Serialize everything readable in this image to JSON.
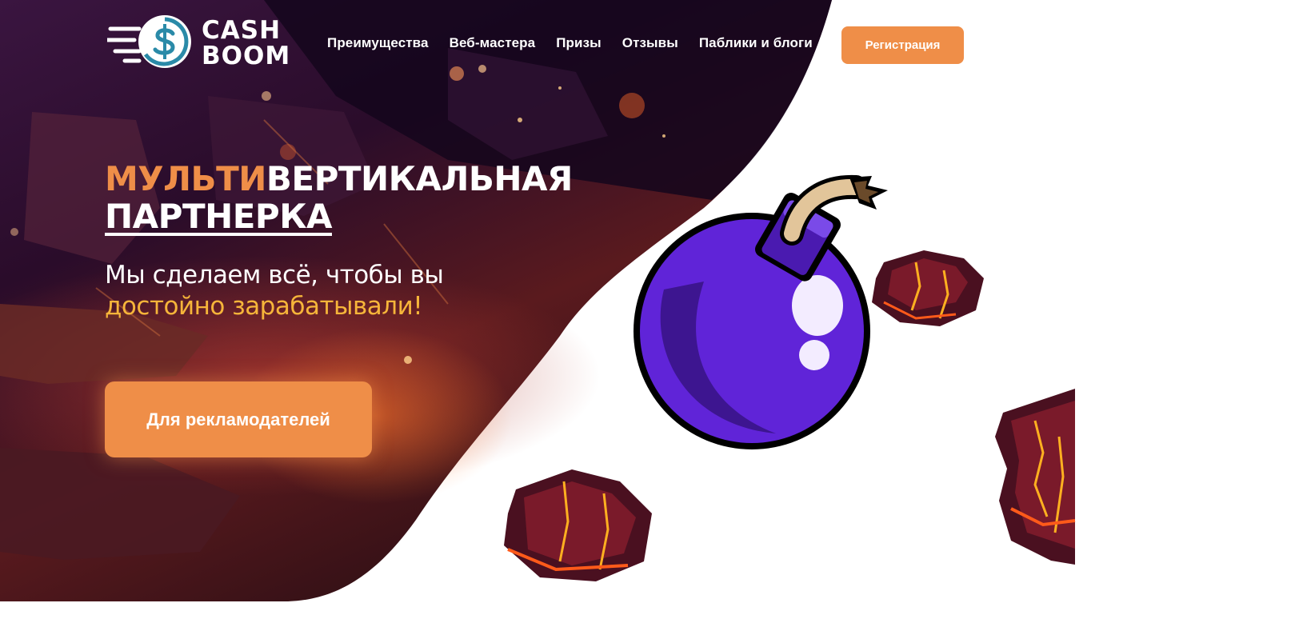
{
  "header": {
    "logo": {
      "line1": "CASH",
      "line2": "BOOM"
    },
    "nav": [
      {
        "label": "Преимущества"
      },
      {
        "label": "Веб-мастера"
      },
      {
        "label": "Призы"
      },
      {
        "label": "Отзывы"
      },
      {
        "label": "Паблики и блоги"
      }
    ],
    "register_label": "Регистрация"
  },
  "hero": {
    "title_accent": "МУЛЬТИ",
    "title_rest": "ВЕРТИКАЛЬНАЯ",
    "title_line2": "ПАРТНЕРКА",
    "subtitle_line1": "Мы сделаем всё, чтобы вы",
    "subtitle_line2": "достойно зарабатывали!",
    "cta_label": "Для рекламодателей"
  },
  "colors": {
    "accent": "#ef8e48",
    "subtitle_accent": "#f6b53a",
    "hero_dark": "#1e0b28",
    "bomb": "#6024d8",
    "logo_ring": "#2a8aa8"
  }
}
